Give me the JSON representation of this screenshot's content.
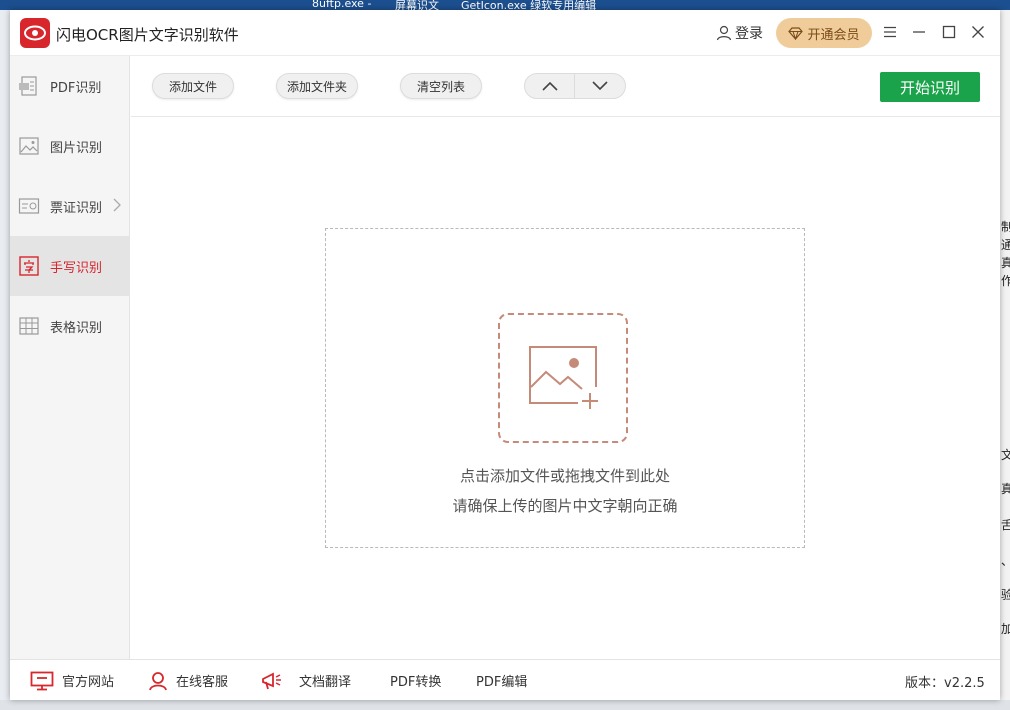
{
  "desktop": {
    "taskbar_items": [
      "8uftp.exe -",
      "屏幕识文",
      "GetIcon.exe 绿软专用编辑"
    ],
    "right_chars": [
      "制",
      "通",
      "真",
      "作",
      "文",
      "真",
      "舌",
      "、",
      "验",
      "加"
    ]
  },
  "app": {
    "title": "闪电OCR图片文字识别软件",
    "login_label": "登录",
    "vip_label": "开通会员",
    "brand_color": "#d8262d"
  },
  "sidebar": {
    "items": [
      {
        "label": "PDF识别",
        "icon": "pdf-icon",
        "active": false
      },
      {
        "label": "图片识别",
        "icon": "image-icon",
        "active": false
      },
      {
        "label": "票证识别",
        "icon": "id-card-icon",
        "active": false
      },
      {
        "label": "手写识别",
        "icon": "handwriting-icon",
        "active": true
      },
      {
        "label": "表格识别",
        "icon": "table-icon",
        "active": false
      }
    ]
  },
  "toolbar": {
    "add_file": "添加文件",
    "add_folder": "添加文件夹",
    "clear_list": "清空列表",
    "start": "开始识别",
    "start_color": "#1aa34a"
  },
  "dropzone": {
    "line1": "点击添加文件或拖拽文件到此处",
    "line2": "请确保上传的图片中文字朝向正确"
  },
  "footer": {
    "website": "官方网站",
    "support": "在线客服",
    "translate": "文档翻译",
    "pdf_convert": "PDF转换",
    "pdf_edit": "PDF编辑",
    "version": "版本：v2.2.5"
  }
}
